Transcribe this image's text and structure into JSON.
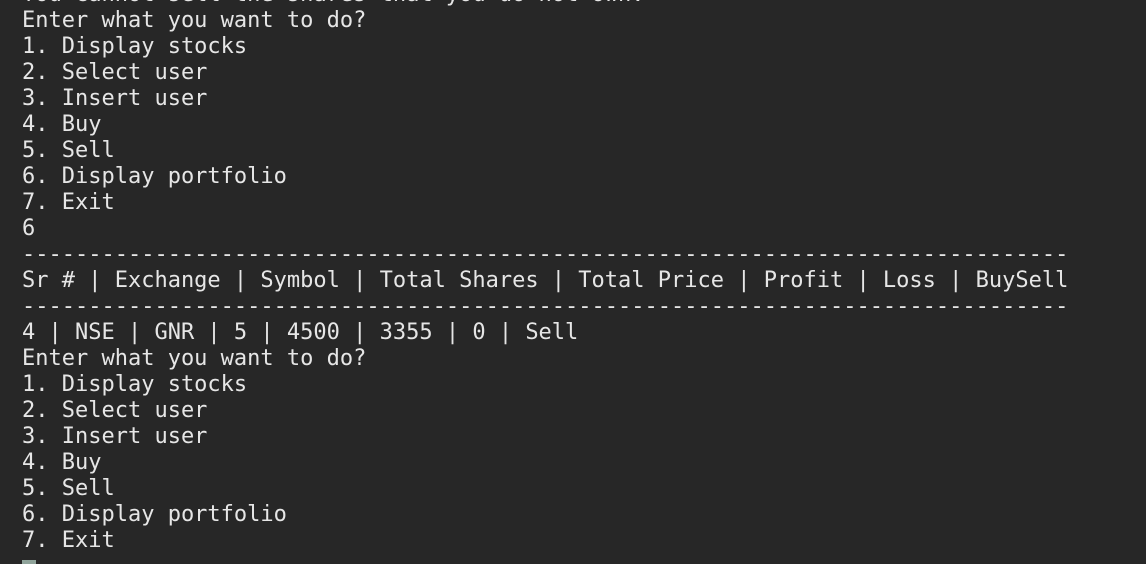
{
  "terminal": {
    "lines": [
      "You cannot sell the shares that you do not own.",
      "Enter what you want to do?",
      "1. Display stocks",
      "2. Select user",
      "3. Insert user",
      "4. Buy",
      "5. Sell",
      "6. Display portfolio",
      "7. Exit",
      "6",
      "-------------------------------------------------------------------------------",
      "Sr # | Exchange | Symbol | Total Shares | Total Price | Profit | Loss | BuySell",
      "-------------------------------------------------------------------------------",
      "4 | NSE | GNR | 5 | 4500 | 3355 | 0 | Sell",
      "Enter what you want to do?",
      "1. Display stocks",
      "2. Select user",
      "3. Insert user",
      "4. Buy",
      "5. Sell",
      "6. Display portfolio",
      "7. Exit"
    ],
    "cursor_color": "#8fa39a",
    "background_color": "#272727",
    "text_color": "#e6e6e6"
  }
}
